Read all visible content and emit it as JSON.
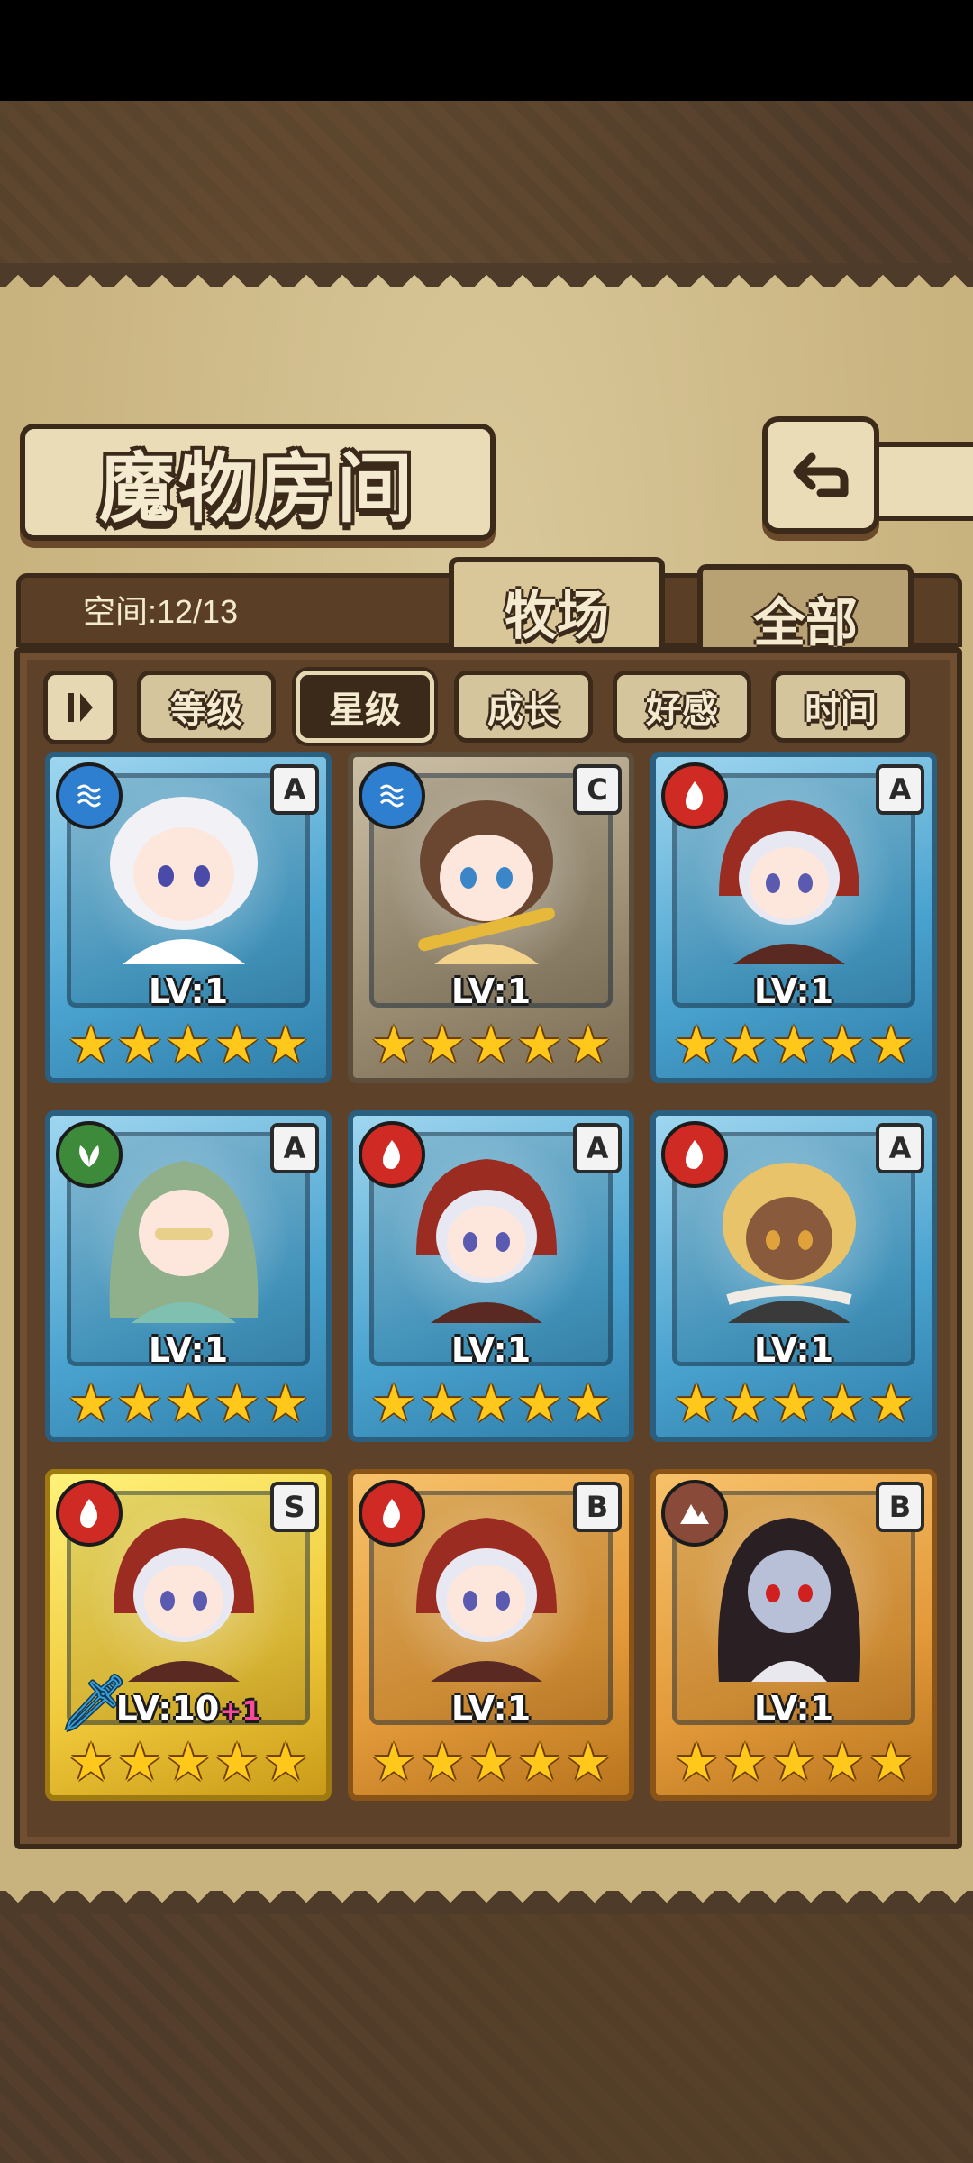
{
  "title": "魔物房间",
  "capacity": {
    "label": "空间:12/13"
  },
  "tabs": [
    {
      "label": "牧场",
      "active": true
    },
    {
      "label": "全部",
      "active": false
    }
  ],
  "sort": {
    "toggle_icon": "sort-order-icon",
    "buttons": [
      {
        "label": "等级",
        "selected": false
      },
      {
        "label": "星级",
        "selected": true
      },
      {
        "label": "成长",
        "selected": false
      },
      {
        "label": "好感",
        "selected": false
      },
      {
        "label": "时间",
        "selected": false
      }
    ]
  },
  "monsters": [
    {
      "element": "water",
      "rank": "A",
      "level": "LV:1",
      "frame": "blue",
      "stars": 5,
      "bonus": ""
    },
    {
      "element": "water",
      "rank": "C",
      "level": "LV:1",
      "frame": "gray",
      "stars": 5,
      "bonus": ""
    },
    {
      "element": "fire",
      "rank": "A",
      "level": "LV:1",
      "frame": "blue",
      "stars": 5,
      "bonus": ""
    },
    {
      "element": "wood",
      "rank": "A",
      "level": "LV:1",
      "frame": "blue",
      "stars": 5,
      "bonus": ""
    },
    {
      "element": "fire",
      "rank": "A",
      "level": "LV:1",
      "frame": "blue",
      "stars": 5,
      "bonus": ""
    },
    {
      "element": "fire",
      "rank": "A",
      "level": "LV:1",
      "frame": "blue",
      "stars": 5,
      "bonus": ""
    },
    {
      "element": "fire",
      "rank": "S",
      "level": "LV:10",
      "frame": "gold",
      "stars": 5,
      "bonus": "+1"
    },
    {
      "element": "fire",
      "rank": "B",
      "level": "LV:1",
      "frame": "orange",
      "stars": 5,
      "bonus": ""
    },
    {
      "element": "earth",
      "rank": "B",
      "level": "LV:1",
      "frame": "orange",
      "stars": 5,
      "bonus": ""
    }
  ],
  "colors": {
    "water": "#2f7fd0",
    "fire": "#cf2a24",
    "wood": "#3c8a3a",
    "earth": "#8a4a3a",
    "star": "#ffc81a"
  }
}
